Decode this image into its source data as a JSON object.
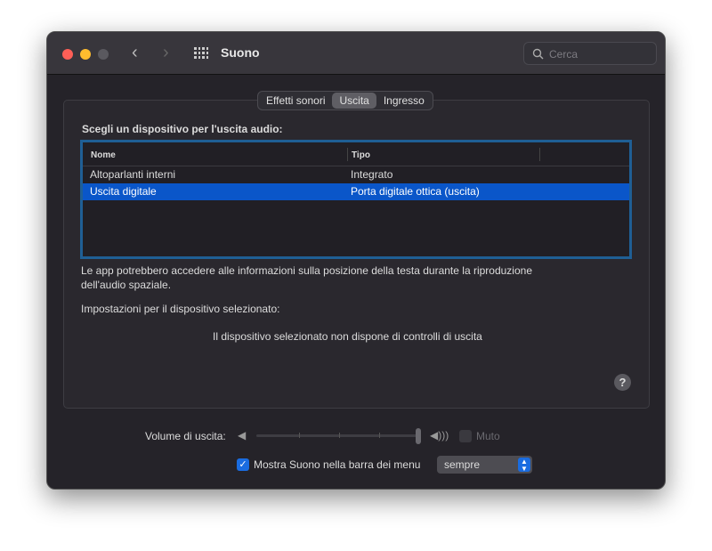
{
  "window": {
    "title": "Suono",
    "search_placeholder": "Cerca"
  },
  "tabs": [
    {
      "label": "Effetti sonori",
      "selected": false
    },
    {
      "label": "Uscita",
      "selected": true
    },
    {
      "label": "Ingresso",
      "selected": false
    }
  ],
  "output": {
    "heading": "Scegli un dispositivo per l'uscita audio:",
    "columns": [
      "Nome",
      "Tipo"
    ],
    "rows": [
      {
        "name": "Altoparlanti interni",
        "type": "Integrato",
        "selected": false
      },
      {
        "name": "Uscita digitale",
        "type": "Porta digitale ottica (uscita)",
        "selected": true
      }
    ],
    "spatial_note_1": "Le app potrebbero accedere alle informazioni sulla posizione della testa durante la riproduzione",
    "spatial_note_2": "dell'audio spaziale.",
    "settings_label": "Impostazioni per il dispositivo selezionato:",
    "no_controls": "Il dispositivo selezionato non dispone di controlli di uscita",
    "help": "?"
  },
  "footer": {
    "volume_label": "Volume di uscita:",
    "volume_value": 1.0,
    "mute_label": "Muto",
    "mute_checked": false,
    "show_in_menu_label": "Mostra Suono nella barra dei menu",
    "show_in_menu_checked": true,
    "show_option": "sempre"
  },
  "colors": {
    "accent": "#0a56c9",
    "table_border": "#1f5f95"
  }
}
